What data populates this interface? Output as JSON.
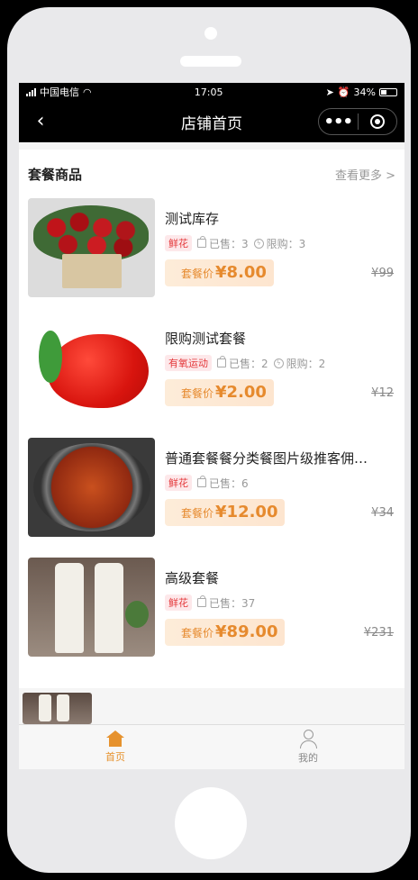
{
  "status_bar": {
    "carrier": "中国电信",
    "time": "17:05",
    "battery": "34%"
  },
  "nav": {
    "title": "店铺首页"
  },
  "section": {
    "title": "套餐商品",
    "view_more": "查看更多 >"
  },
  "products": [
    {
      "name": "测试库存",
      "tag": "鲜花",
      "sold": "已售：3",
      "limit": "限购：3",
      "price_label": "套餐价",
      "price": "¥8.00",
      "original_price": "¥99"
    },
    {
      "name": "限购测试套餐",
      "tag": "有氧运动",
      "sold": "已售：2",
      "limit": "限购：2",
      "price_label": "套餐价",
      "price": "¥2.00",
      "original_price": "¥12"
    },
    {
      "name": "普通套餐餐分类餐图片级推客佣…",
      "tag": "鲜花",
      "sold": "已售：6",
      "price_label": "套餐价",
      "price": "¥12.00",
      "original_price": "¥34"
    },
    {
      "name": "高级套餐",
      "tag": "鲜花",
      "sold": "已售：37",
      "price_label": "套餐价",
      "price": "¥89.00",
      "original_price": "¥231"
    }
  ],
  "tab_bar": {
    "home": "首页",
    "mine": "我的"
  },
  "colors": {
    "accent": "#e6922e",
    "tag_text": "#e4393c",
    "tag_bg": "#fde8ea"
  }
}
